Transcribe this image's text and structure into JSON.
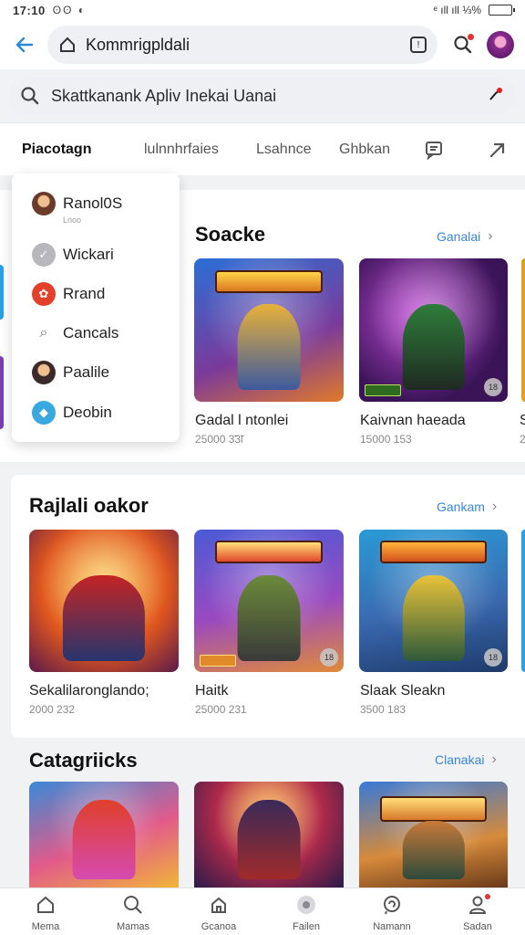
{
  "status": {
    "time": "17:10",
    "icons": "ʘʘ ◐",
    "right": "ᵉ ıll ıll ⅓%"
  },
  "battery_level": 0.5,
  "topbar": {
    "address": "Kommrigpldali"
  },
  "search": {
    "placeholder": "Skattkanank Apliv Inekai Uanai"
  },
  "tabs": [
    "Piacotagn",
    "lulnnhrfaies",
    "Lsahnce",
    "Ghbkan"
  ],
  "dropdown": {
    "items": [
      "Ranol0S",
      "Wickari",
      "Rrand",
      "Cancals",
      "Paalile",
      "Deobin"
    ],
    "subtext": "Lnoo"
  },
  "sections": [
    {
      "title": "Soacke",
      "link": "Ganalai",
      "games": [
        {
          "name": "Gadal l ntonlei",
          "meta": "25000 3̃3̃l"
        },
        {
          "name": "Kaivnan haeada",
          "meta": "15000 153"
        },
        {
          "name": "S",
          "meta": "2"
        }
      ]
    },
    {
      "title": "Rajlali oakor",
      "link": "Gankam",
      "games": [
        {
          "name": "Sekalilaronglando;",
          "meta": "2000 232"
        },
        {
          "name": "Haitk",
          "meta": "25000 231"
        },
        {
          "name": "Slaak Sleakn",
          "meta": "3500 183"
        }
      ]
    },
    {
      "title": "Catagriicks",
      "link": "Clanakai",
      "games": []
    }
  ],
  "thumb_titles": [
    "SANGIANS",
    "VHKKAS",
    "HANTAN",
    "NAUNRAS"
  ],
  "thumb_tags": [
    "DOOOS",
    "COOOS"
  ],
  "bottom_nav": [
    "Mema",
    "Mamas",
    "Gcanoa",
    "Failen",
    "Namann",
    "Sadan"
  ],
  "colors": {
    "accent": "#3a86d6",
    "alert": "#e63232"
  }
}
